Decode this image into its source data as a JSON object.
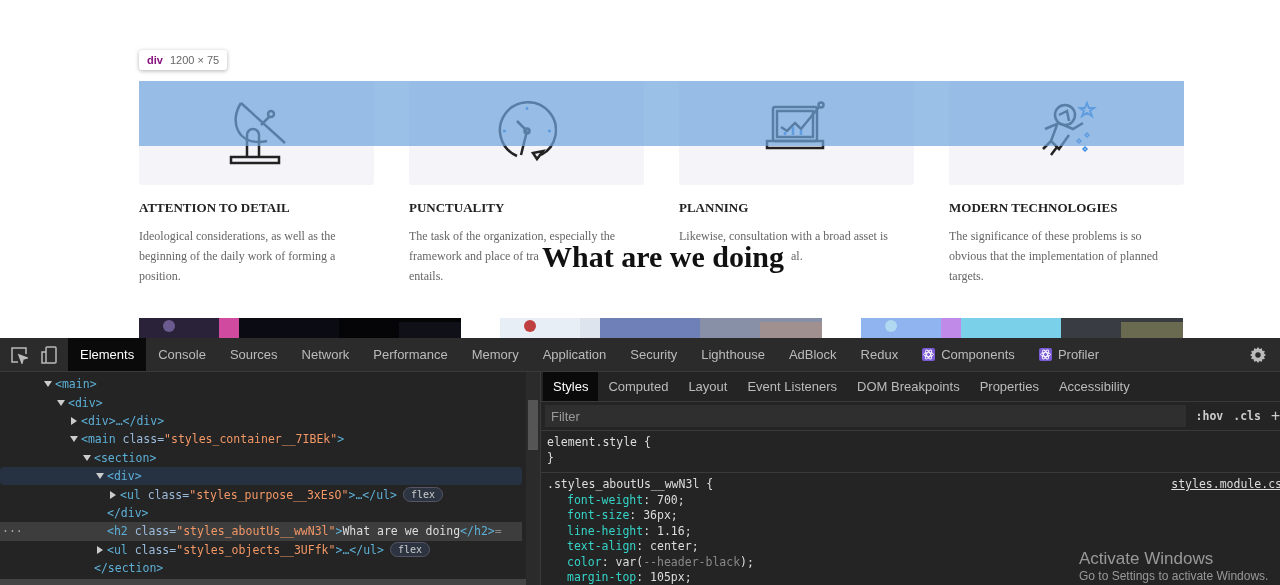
{
  "page": {
    "tooltip": {
      "tag": "div",
      "size": "1200 × 75"
    },
    "features": [
      {
        "title": "ATTENTION TO DETAIL",
        "lines": [
          {
            "text": "Ideological considerations, as well as the"
          },
          {
            "text": "beginning of the daily work of forming a"
          },
          {
            "text": "position."
          }
        ]
      },
      {
        "title": "PUNCTUALITY",
        "lines": [
          {
            "text": "The task of the organization, especially the"
          },
          {
            "text": "framework and place of tra"
          },
          {
            "text": "entails."
          }
        ]
      },
      {
        "title": "PLANNING",
        "lines": [
          {
            "text": "Likewise, consultation with a broad asset is"
          },
          {
            "text": "al.",
            "kind": "after_heading"
          }
        ]
      },
      {
        "title": "MODERN TECHNOLOGIES",
        "lines": [
          {
            "text": "The significance of these problems is so"
          },
          {
            "text": "obvious that the implementation of planned"
          },
          {
            "text": "targets."
          }
        ]
      }
    ],
    "heading": "What are we doing"
  },
  "devtools": {
    "tabs": [
      {
        "label": "Elements",
        "selected": true
      },
      {
        "label": "Console",
        "selected": false
      },
      {
        "label": "Sources",
        "selected": false
      },
      {
        "label": "Network",
        "selected": false
      },
      {
        "label": "Performance",
        "selected": false
      },
      {
        "label": "Memory",
        "selected": false
      },
      {
        "label": "Application",
        "selected": false
      },
      {
        "label": "Security",
        "selected": false
      },
      {
        "label": "Lighthouse",
        "selected": false
      },
      {
        "label": "AdBlock",
        "selected": false
      },
      {
        "label": "Redux",
        "selected": false
      },
      {
        "label": "Components",
        "selected": false,
        "kind": "react"
      },
      {
        "label": "Profiler",
        "selected": false,
        "kind": "react"
      }
    ],
    "dom": [
      {
        "open": "<main",
        "end": ">",
        "expanded": true,
        "selected": false,
        "hovered": false,
        "children": [
          {
            "open": "<div",
            "end": ">",
            "expanded": true,
            "selected": false,
            "hovered": false,
            "children": [
              {
                "open": "<div",
                "end": ">…</div>",
                "expanded": false,
                "selected": false,
                "hovered": false
              },
              {
                "open": "<main",
                "attr": "class=",
                "value": "\"styles_container__7IBEk\"",
                "end": ">",
                "expanded": true,
                "selected": false,
                "hovered": false,
                "children": [
                  {
                    "open": "<section",
                    "end": ">",
                    "expanded": true,
                    "selected": false,
                    "hovered": false,
                    "close": "</section>",
                    "children": [
                      {
                        "open": "<div",
                        "end": ">",
                        "expanded": true,
                        "selected": false,
                        "hovered": true,
                        "close": "</div>",
                        "children": [
                          {
                            "open": "<ul",
                            "attr": "class=",
                            "value": "\"styles_purpose__3xEsO\"",
                            "end": ">…</ul>",
                            "expanded": false,
                            "selected": false,
                            "hovered": false,
                            "badge": "flex"
                          }
                        ]
                      },
                      {
                        "open": "<h2",
                        "attr": "class=",
                        "value": "\"styles_aboutUs__wwN3l\"",
                        "end": ">",
                        "text": "What are we doing",
                        "after": "</h2>",
                        "suffix": "=",
                        "gutter": "···",
                        "selected": true,
                        "hovered": false
                      },
                      {
                        "open": "<ul",
                        "attr": "class=",
                        "value": "\"styles_objects__3UFfk\"",
                        "end": ">…</ul>",
                        "expanded": false,
                        "selected": false,
                        "hovered": false,
                        "badge": "flex"
                      }
                    ]
                  }
                ]
              }
            ]
          }
        ]
      }
    ],
    "side_tabs": [
      {
        "label": "Styles",
        "selected": true
      },
      {
        "label": "Computed",
        "selected": false
      },
      {
        "label": "Layout",
        "selected": false
      },
      {
        "label": "Event Listeners",
        "selected": false
      },
      {
        "label": "DOM Breakpoints",
        "selected": false
      },
      {
        "label": "Properties",
        "selected": false
      },
      {
        "label": "Accessibility",
        "selected": false
      }
    ],
    "filter": {
      "placeholder": "Filter",
      "hov": ":hov",
      "cls": ".cls",
      "add": "+"
    },
    "rules": [
      {
        "selector": "element.style {",
        "close": "}"
      },
      {
        "selector": ".styles_aboutUs__wwN3l {",
        "source": "styles.module.cs",
        "declarations": [
          {
            "name": "font-weight",
            "value": ": 700;"
          },
          {
            "name": "font-size",
            "value": ": 36px;"
          },
          {
            "name": "line-height",
            "value": ": 1.16;"
          },
          {
            "name": "text-align",
            "value": ": center;"
          },
          {
            "name": "color",
            "value": ": var(",
            "dim": "--header-black",
            "tail": ");"
          },
          {
            "name": "margin-top",
            "value": ": 105px;"
          }
        ]
      }
    ]
  },
  "activation": {
    "title": "Activate Windows",
    "subtitle": "Go to Settings to activate Windows."
  }
}
